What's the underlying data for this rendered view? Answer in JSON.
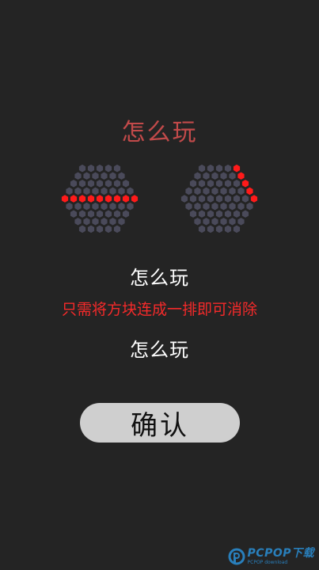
{
  "title": "怎么玩",
  "diagrams": {
    "left": {
      "highlight": "middle-row",
      "description_icon": "hex-board-horizontal-line"
    },
    "right": {
      "highlight": "right-diagonal-edge",
      "description_icon": "hex-board-diagonal-line"
    }
  },
  "subheading_top": "怎么玩",
  "instruction": "只需将方块连成一排即可消除",
  "subheading_bottom": "怎么玩",
  "confirm_label": "确认",
  "colors": {
    "background": "#242424",
    "title": "#c24a4a",
    "instruction": "#f52a2a",
    "cell_empty": "#4a4a5a",
    "cell_filled": "#ff1a1a",
    "button_bg": "#cfcfcf"
  },
  "watermark": {
    "text": "PCPOP下载",
    "sub": "PCPOP download"
  }
}
